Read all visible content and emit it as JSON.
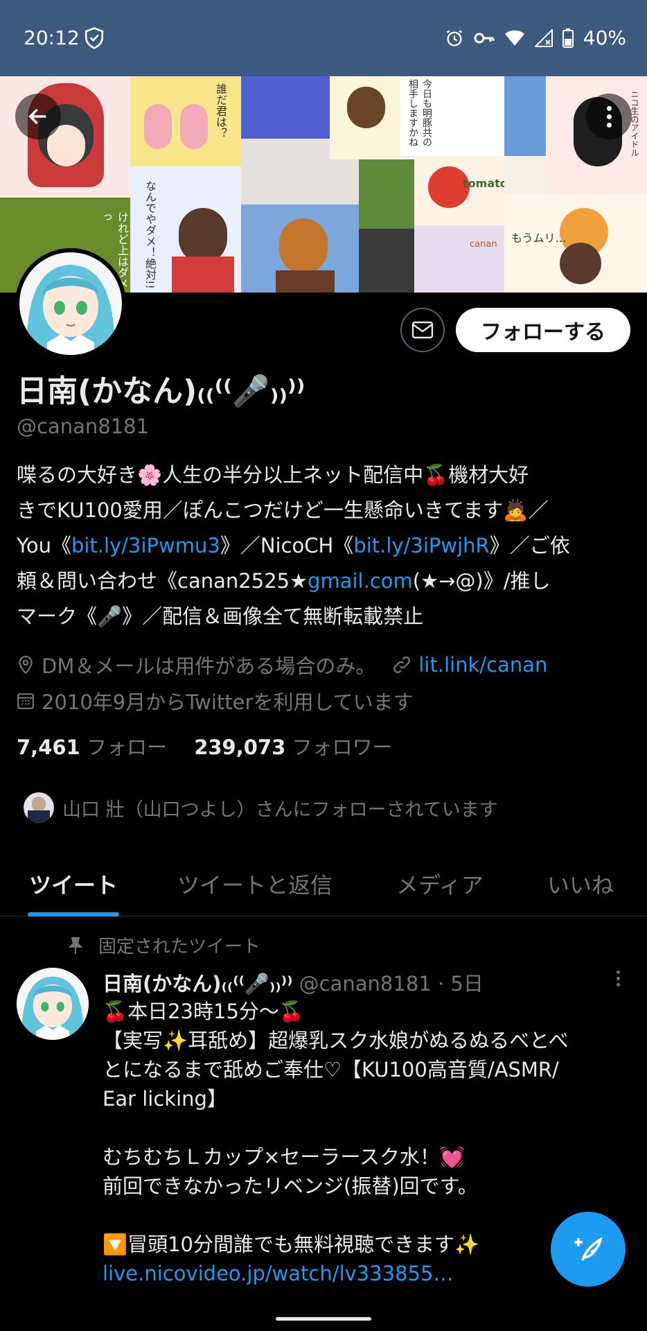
{
  "status_bar": {
    "time": "20:12",
    "battery": "40%",
    "icons": [
      "shield-icon",
      "alarm-icon",
      "key-icon",
      "wifi-icon",
      "signal-icon",
      "battery-icon"
    ]
  },
  "header": {
    "banner_texts": [
      "誰だ君は？",
      "今日も明豚共の相手しますかね",
      "なんでやダメ！絶対!!",
      "下のお口はイイけれど上はダメっ",
      "tomato?",
      "canan",
      "もうムリ…",
      "ニコ生のアイドル"
    ],
    "back_icon": "arrow-left-icon",
    "more_icon": "more-vertical-icon"
  },
  "profile": {
    "follow_label": "フォローする",
    "name": "日南(かなん)₍₍⁽⁽🎤₎₎⁾⁾",
    "handle": "@canan8181",
    "bio": {
      "l1": "喋るの大好き🌸人生の半分以上ネット配信中🍒機材大好",
      "l2": "きでKU100愛用／ぽんこつだけど一生懸命いきてます🙇／",
      "l3_a": "You《",
      "l3_link1": "bit.ly/3iPwmu3",
      "l3_b": "》／NicoCH《",
      "l3_link2": "bit.ly/3iPwjhR",
      "l3_c": "》／ご依",
      "l4_a": "頼＆問い合わせ《canan2525★",
      "l4_link": "gmail.com",
      "l4_b": "(★→@)》/推し",
      "l5": "マーク《🎤》／配信＆画像全て無断転載禁止"
    },
    "location": "DM＆メールは用件がある場合のみ。",
    "website": "lit.link/canan",
    "joined": "2010年9月からTwitterを利用しています",
    "following_count": "7,461",
    "following_label": "フォロー",
    "followers_count": "239,073",
    "followers_label": "フォロワー",
    "followed_by": "山口 壯（山口つよし）さんにフォローされています"
  },
  "tabs": [
    "ツイート",
    "ツイートと返信",
    "メディア",
    "いいね"
  ],
  "active_tab": 0,
  "pinned_tweet": {
    "pinned_label": "固定されたツイート",
    "author_name": "日南(かなん)₍₍⁽⁽🎤₎₎⁾⁾",
    "author_meta": "@canan8181 · 5日",
    "lines": [
      "🍒本日23時15分～🍒",
      "【実写✨耳舐め】超爆乳スク水娘がぬるぬるべとべ",
      "とになるまで舐めご奉仕♡【KU100高音質/ASMR/",
      "Ear licking】",
      "",
      "むちむちＬカップ×セーラースク水！💓",
      "前回できなかったリベンジ(振替)回です。",
      "",
      "🔽冒頭10分間誰でも無料視聴できます✨"
    ],
    "link": "live.nicovideo.jp/watch/lv333855…"
  },
  "fab_icon": "compose-tweet-icon",
  "colors": {
    "accent": "#1d9bf0",
    "status_bar": "#3c5a7e",
    "muted": "#71767b"
  }
}
